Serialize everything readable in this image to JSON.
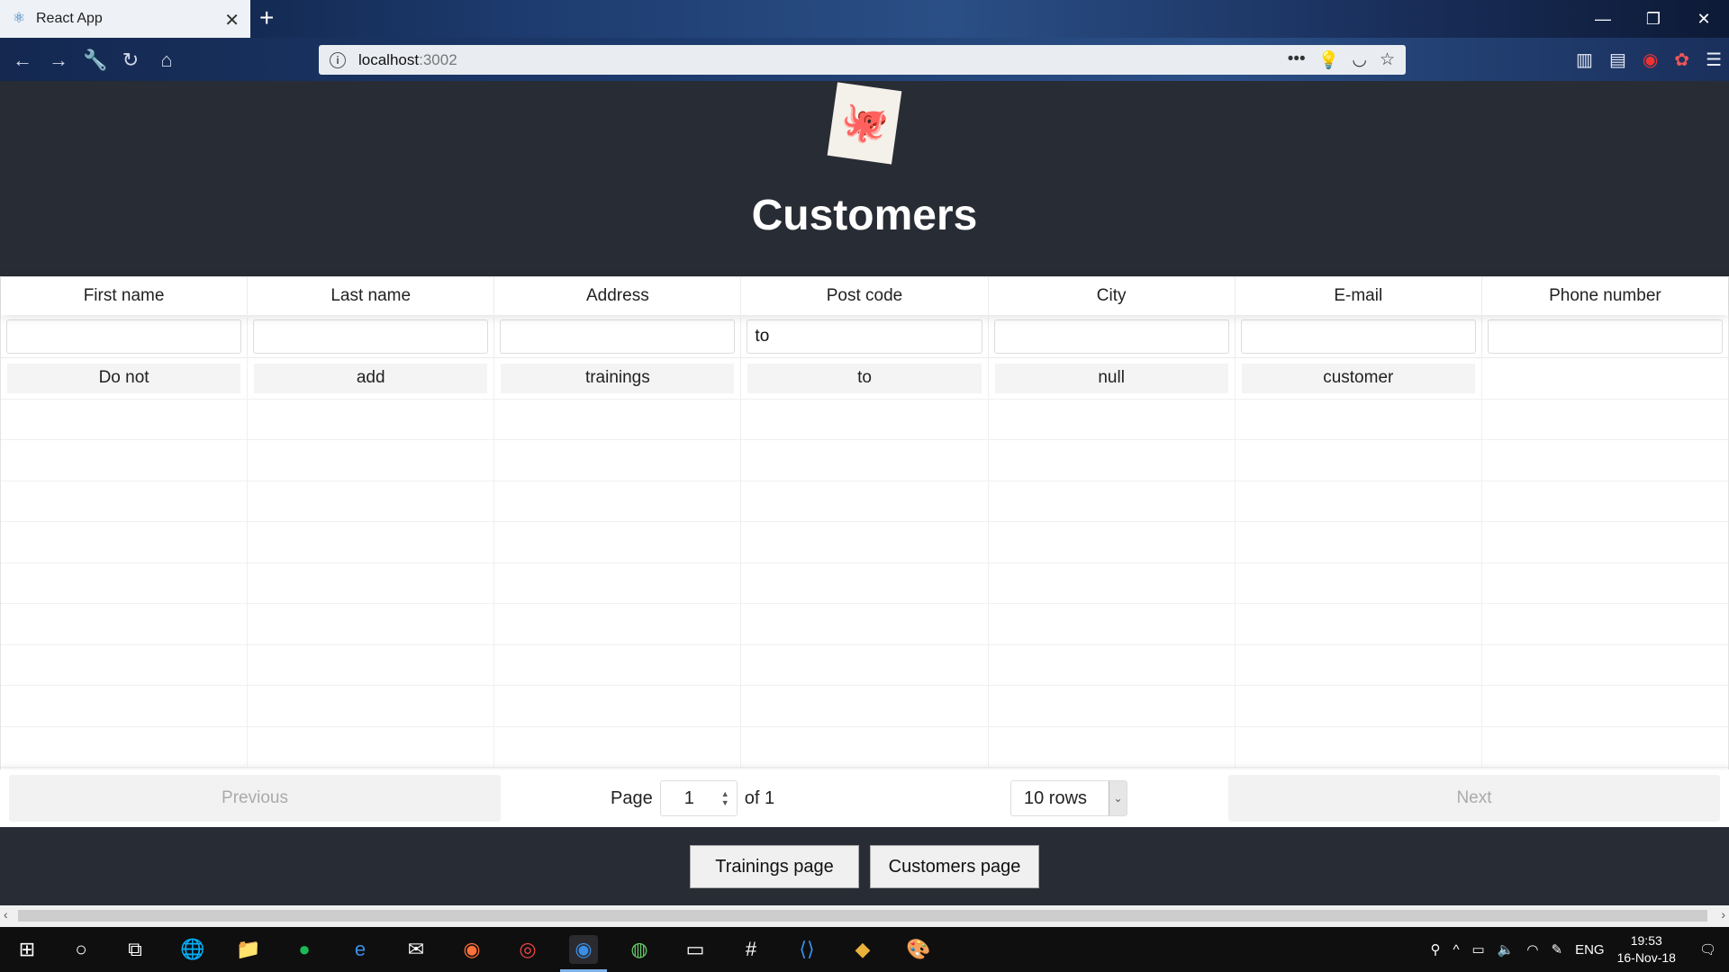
{
  "browser": {
    "tab_title": "React App",
    "url_host": "localhost",
    "url_port": ":3002"
  },
  "app": {
    "title": "Customers"
  },
  "table": {
    "columns": [
      "First name",
      "Last name",
      "Address",
      "Post code",
      "City",
      "E-mail",
      "Phone number"
    ],
    "filters": [
      "",
      "",
      "",
      "to",
      "",
      "",
      ""
    ],
    "rows": [
      [
        "Do not",
        "add",
        "trainings",
        "to",
        "null",
        "customer",
        ""
      ]
    ]
  },
  "pagination": {
    "previous_label": "Previous",
    "next_label": "Next",
    "page_label": "Page",
    "current_page": "1",
    "of_label": "of 1",
    "rows_option": "10 rows"
  },
  "bottom_nav": {
    "trainings_label": "Trainings page",
    "customers_label": "Customers page"
  },
  "taskbar": {
    "language": "ENG",
    "time": "19:53",
    "date": "16-Nov-18"
  }
}
